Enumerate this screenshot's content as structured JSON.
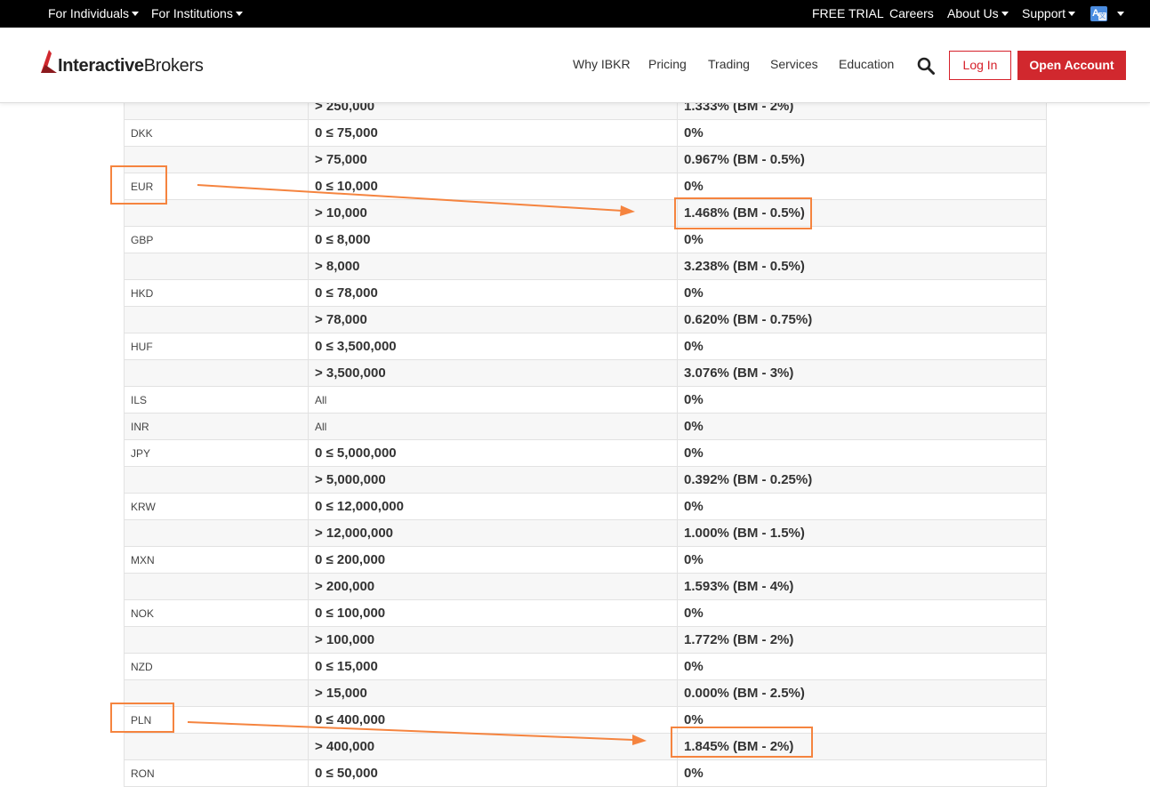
{
  "topbar": {
    "for_individuals": "For Individuals",
    "for_institutions": "For Institutions",
    "free_trial": "FREE TRIAL",
    "careers": "Careers",
    "about_us": "About Us",
    "support": "Support"
  },
  "header": {
    "logo_bold": "Interactive",
    "logo_light": "Brokers",
    "nav": [
      "Why IBKR",
      "Pricing",
      "Trading",
      "Services",
      "Education"
    ],
    "login_label": "Log In",
    "open_account_label": "Open Account"
  },
  "colors": {
    "brand_red": "#d1282e",
    "highlight_orange": "#f5843f"
  },
  "table": {
    "rows": [
      {
        "currency": "",
        "range": "> 250,000",
        "rate": "1.333% (BM - 2%)"
      },
      {
        "currency": "DKK",
        "range": "0 ≤ 75,000",
        "rate": "0%"
      },
      {
        "currency": "",
        "range": "> 75,000",
        "rate": "0.967% (BM - 0.5%)"
      },
      {
        "currency": "EUR",
        "range": "0 ≤ 10,000",
        "rate": "0%"
      },
      {
        "currency": "",
        "range": "> 10,000",
        "rate": "1.468% (BM - 0.5%)"
      },
      {
        "currency": "GBP",
        "range": "0 ≤ 8,000",
        "rate": "0%"
      },
      {
        "currency": "",
        "range": "> 8,000",
        "rate": "3.238% (BM - 0.5%)"
      },
      {
        "currency": "HKD",
        "range": "0 ≤ 78,000",
        "rate": "0%"
      },
      {
        "currency": "",
        "range": "> 78,000",
        "rate": "0.620% (BM - 0.75%)"
      },
      {
        "currency": "HUF",
        "range": "0 ≤ 3,500,000",
        "rate": "0%"
      },
      {
        "currency": "",
        "range": "> 3,500,000",
        "rate": "3.076% (BM - 3%)"
      },
      {
        "currency": "ILS",
        "range": "All",
        "rate": "0%"
      },
      {
        "currency": "INR",
        "range": "All",
        "rate": "0%"
      },
      {
        "currency": "JPY",
        "range": "0 ≤ 5,000,000",
        "rate": "0%"
      },
      {
        "currency": "",
        "range": "> 5,000,000",
        "rate": "0.392% (BM - 0.25%)"
      },
      {
        "currency": "KRW",
        "range": "0 ≤ 12,000,000",
        "rate": "0%"
      },
      {
        "currency": "",
        "range": "> 12,000,000",
        "rate": "1.000% (BM - 1.5%)"
      },
      {
        "currency": "MXN",
        "range": "0 ≤ 200,000",
        "rate": "0%"
      },
      {
        "currency": "",
        "range": "> 200,000",
        "rate": "1.593% (BM - 4%)"
      },
      {
        "currency": "NOK",
        "range": "0 ≤ 100,000",
        "rate": "0%"
      },
      {
        "currency": "",
        "range": "> 100,000",
        "rate": "1.772% (BM - 2%)"
      },
      {
        "currency": "NZD",
        "range": "0 ≤ 15,000",
        "rate": "0%"
      },
      {
        "currency": "",
        "range": "> 15,000",
        "rate": "0.000% (BM - 2.5%)"
      },
      {
        "currency": "PLN",
        "range": "0 ≤ 400,000",
        "rate": "0%"
      },
      {
        "currency": "",
        "range": "> 400,000",
        "rate": "1.845% (BM - 2%)"
      },
      {
        "currency": "RON",
        "range": "0 ≤ 50,000",
        "rate": "0%"
      }
    ]
  }
}
